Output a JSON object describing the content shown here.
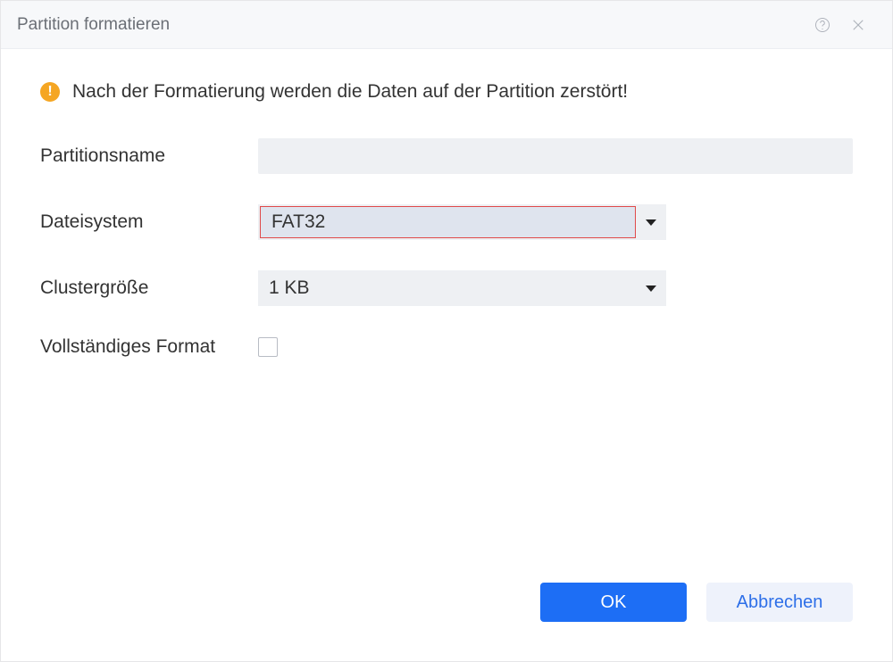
{
  "window": {
    "title": "Partition formatieren"
  },
  "warning": {
    "text": "Nach der Formatierung werden die Daten auf der Partition zerstört!"
  },
  "fields": {
    "partition_name": {
      "label": "Partitionsname",
      "value": ""
    },
    "filesystem": {
      "label": "Dateisystem",
      "value": "FAT32"
    },
    "cluster_size": {
      "label": "Clustergröße",
      "value": "1 KB"
    },
    "full_format": {
      "label": "Vollständiges Format",
      "checked": false
    }
  },
  "buttons": {
    "ok": "OK",
    "cancel": "Abbrechen"
  }
}
